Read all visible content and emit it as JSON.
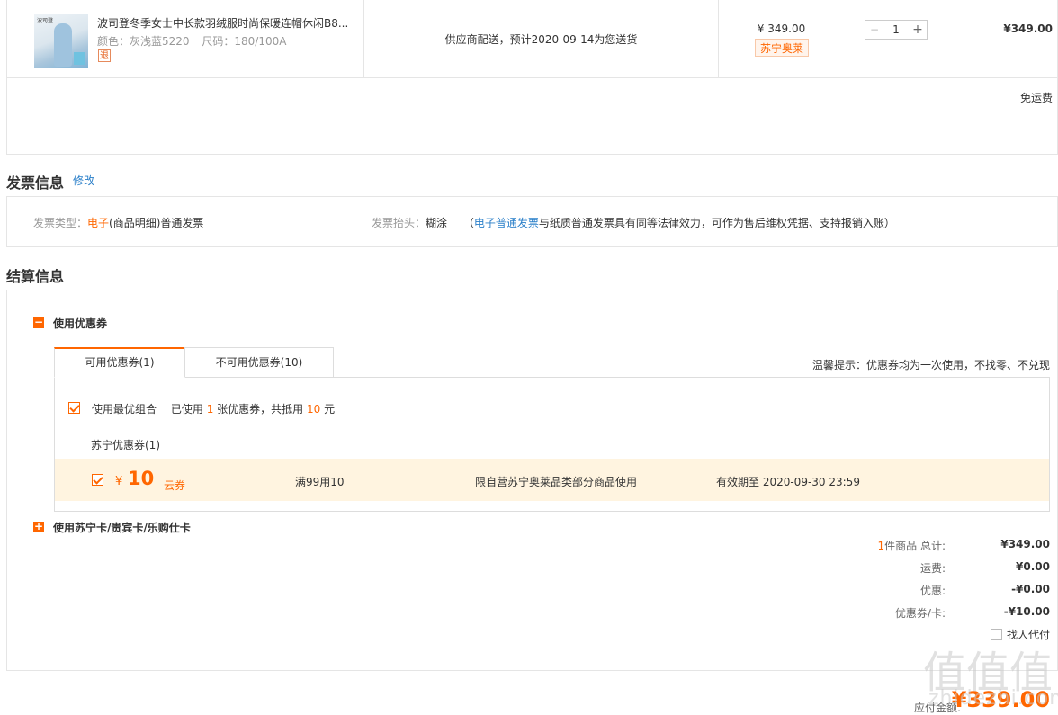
{
  "product": {
    "thumb_brand": "波司登",
    "name": "波司登冬季女士中长款羽绒服时尚保暖连帽休闲B8...",
    "color_label": "颜色：",
    "color": "灰浅蓝5220",
    "size_label": "尺码：",
    "size": "180/100A",
    "return_badge": "退",
    "delivery": "供应商配送，预计2020-09-14为您送货",
    "price": "¥ 349.00",
    "store_badge": "苏宁奥莱",
    "qty_minus": "−",
    "qty": "1",
    "qty_plus": "+",
    "subtotal": "¥349.00",
    "shipping_note": "免运费"
  },
  "invoice": {
    "title": "发票信息",
    "edit_link": "修改",
    "type_label": "发票类型：",
    "type_highlight": "电子",
    "type_rest": "(商品明细)普通发票",
    "header_label": "发票抬头：",
    "header_value": "糊涂",
    "note_open": "（",
    "note_link": "电子普通发票",
    "note_rest": "与纸质普通发票具有同等法律效力，可作为售后维权凭据、支持报销入账）"
  },
  "settlement": {
    "title": "结算信息",
    "coupon_section_icon": "−",
    "coupon_section_label": "使用优惠券",
    "tabs": [
      {
        "label": "可用优惠券(1)"
      },
      {
        "label": "不可用优惠券(10)"
      }
    ],
    "tip": "温馨提示：优惠券均为一次使用，不找零、不兑现",
    "best_combo_label": "使用最优组合",
    "used_prefix": "已使用",
    "used_count": "1",
    "used_mid": "张优惠券，共抵用",
    "used_amount": "10",
    "used_unit": "元",
    "group_title": "苏宁优惠券(1)",
    "coupon": {
      "currency": "¥",
      "amount": "10",
      "type": "云券",
      "condition": "满99用10",
      "scope": "限自营苏宁奥莱品类部分商品使用",
      "validity": "有效期至 2020-09-30 23:59"
    },
    "card_section_icon": "+",
    "card_section_label": "使用苏宁卡/贵宾卡/乐购仕卡"
  },
  "summary": {
    "count": "1",
    "count_suffix": "件商品 总计:",
    "total": "¥349.00",
    "shipping_label": "运费:",
    "shipping": "¥0.00",
    "discount_label": "优惠:",
    "discount": "-¥0.00",
    "coupon_label": "优惠券/卡:",
    "coupon_value": "-¥10.00",
    "pay_for_me": "找人代付",
    "payable_label": "应付金额:",
    "payable": "¥339.00"
  },
  "watermark": {
    "logo": "值",
    "site": "zhidezhi.com"
  },
  "colors": {
    "accent": "#ff6600",
    "link": "#2a7fc9",
    "coupon_bg": "#fff4e0",
    "border": "#e5e5e5"
  }
}
